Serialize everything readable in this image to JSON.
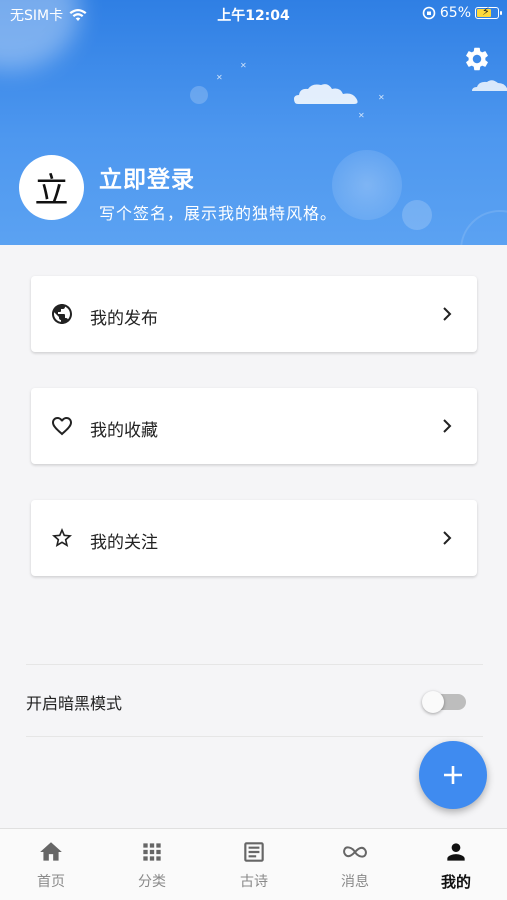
{
  "status_bar": {
    "carrier": "无SIM卡",
    "time": "上午12:04",
    "battery": "65%"
  },
  "profile": {
    "avatar_char": "立",
    "title": "立即登录",
    "signature": "写个签名，展示我的独特风格。"
  },
  "menu": [
    {
      "label": "我的发布",
      "icon": "globe-icon"
    },
    {
      "label": "我的收藏",
      "icon": "heart-icon"
    },
    {
      "label": "我的关注",
      "icon": "star-icon"
    }
  ],
  "settings": {
    "dark_mode_label": "开启暗黑模式",
    "dark_mode_on": false
  },
  "fab": {
    "icon": "plus-icon"
  },
  "tabs": [
    {
      "label": "首页",
      "icon": "home-icon",
      "active": false
    },
    {
      "label": "分类",
      "icon": "grid-icon",
      "active": false
    },
    {
      "label": "古诗",
      "icon": "article-icon",
      "active": false
    },
    {
      "label": "消息",
      "icon": "infinity-icon",
      "active": false
    },
    {
      "label": "我的",
      "icon": "person-icon",
      "active": true
    }
  ],
  "colors": {
    "header_blue": "#3a8aea",
    "fab_blue": "#3f8bf0",
    "background": "#f5f5f7",
    "battery_yellow": "#ffd93b"
  }
}
